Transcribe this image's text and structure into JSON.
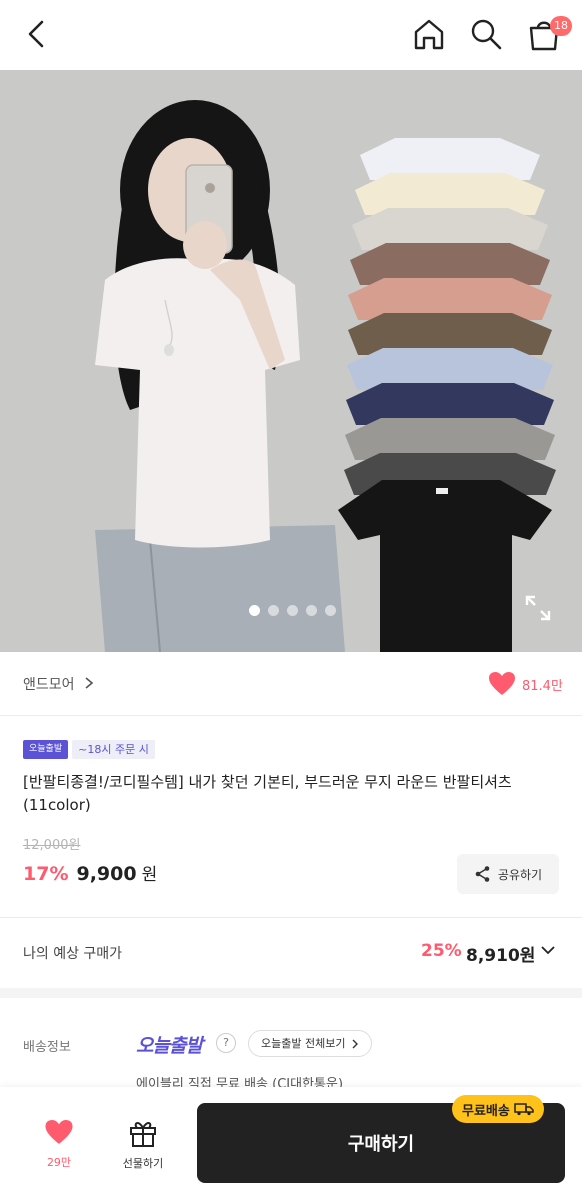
{
  "header": {
    "back_icon": "chevron-left-icon",
    "home_icon": "home-icon",
    "search_icon": "search-icon",
    "cart_icon": "shopping-bag-icon",
    "cart_count": "18"
  },
  "gallery": {
    "total_slides": 5,
    "active_slide": 1,
    "expand_icon": "fullscreen-icon"
  },
  "brand": {
    "name": "앤드모어",
    "like_count": "81.4만"
  },
  "product": {
    "tag_today": "오늘출발",
    "tag_order_cutoff": "~18시 주문 시",
    "title": "[반팔티종결!/코디필수템] 내가 찾던 기본티, 부드러운 무지 라운드 반팔티셔츠 (11color)",
    "original_price": "12,000원",
    "discount": "17%",
    "price": "9,900",
    "currency": "원",
    "share_label": "공유하기"
  },
  "expected": {
    "label": "나의 예상 구매가",
    "discount": "25%",
    "price": "8,910원"
  },
  "shipping": {
    "label": "배송정보",
    "logo_text": "오늘출발",
    "help": "?",
    "view_all": "오늘출발 전체보기",
    "detail": "에이블리 직접 무료 배송 (CJ대한통운)"
  },
  "bottom_bar": {
    "wish_count": "29만",
    "gift_label": "선물하기",
    "buy_label": "구매하기",
    "free_shipping_badge": "무료배송"
  },
  "colors": {
    "accent_pink": "#ff5a6e",
    "accent_purple": "#5b52d6",
    "badge_yellow": "#ffc21a",
    "buy_button": "#222222"
  }
}
